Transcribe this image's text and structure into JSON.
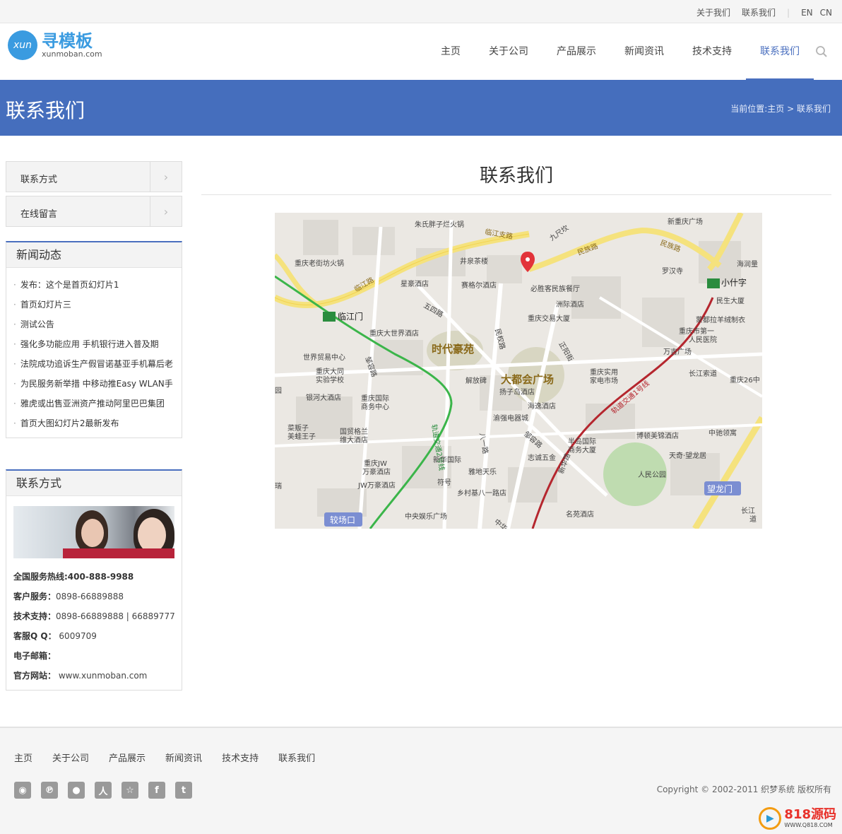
{
  "topbar": {
    "about": "关于我们",
    "contact": "联系我们",
    "en": "EN",
    "cn": "CN"
  },
  "logo": {
    "badge": "xun",
    "brand": "寻模板",
    "domain": "xunmoban.com"
  },
  "nav": {
    "items": [
      "主页",
      "关于公司",
      "产品展示",
      "新闻资讯",
      "技术支持",
      "联系我们"
    ],
    "active": "联系我们"
  },
  "banner": {
    "title": "联系我们",
    "breadcrumb": "当前位置:主页 > 联系我们"
  },
  "sidebar": {
    "buttons": [
      "联系方式",
      "在线留言"
    ],
    "news_title": "新闻动态",
    "news": [
      "发布：这个是首页幻灯片1",
      "首页幻灯片三",
      "测试公告",
      "强化多功能应用 手机银行进入普及期",
      "法院成功追诉生产假冒诺基亚手机幕后老",
      "为民服务新举措 中移动推Easy WLAN手",
      "雅虎或出售亚洲资产推动阿里巴巴集团",
      "首页大图幻灯片2最新发布"
    ],
    "contact_title": "联系方式",
    "contact": {
      "hotline_label": "全国服务热线:400-888-9988",
      "service_label": "客户服务：",
      "service_value": "0898-66889888",
      "tech_label": "技术支持：",
      "tech_value": "0898-66889888 | 66889777",
      "qq_label": "客服Q Q：",
      "qq_value": "6009709",
      "email_label": "电子邮箱：",
      "email_value": "",
      "site_label": "官方网站：",
      "site_value": "www.xunmoban.com"
    }
  },
  "main": {
    "title": "联系我们"
  },
  "map": {
    "labels": {
      "zhushi": "朱氏胖子烂火锅",
      "linjiangzhilu": "临江支路",
      "jiuchikan": "九尺坎",
      "xinchongqing": "新重庆广场",
      "laojiefang": "重庆老街坊火锅",
      "jingquan": "井泉茶楼",
      "minzulu": "民族路",
      "minzulu2": "民族路",
      "luohansi": "罗汉寺",
      "haiyun": "海润量",
      "linjianglu": "临江路",
      "xinghao": "星豪酒店",
      "saigeer": "赛格尔酒店",
      "bisheng": "必胜客民族餐厅",
      "xiaoshizi": "小什字",
      "zhouji": "洲际酒店",
      "minsheng": "民生大厦",
      "linjiangmen": "临江门",
      "wusilu": "五四路",
      "jiaoyi": "重庆交易大厦",
      "mengdula": "蒙都拉羊绒制衣",
      "shijie": "重庆大世界酒店",
      "minquanlu": "民权路",
      "zhengyang": "正阳街",
      "yiyuan1": "重庆市第一",
      "yiyuan2": "人民医院",
      "shidai": "时代豪苑",
      "wanji": "万吉广场",
      "maoyi": "世界贸易中心",
      "datong1": "重庆大同",
      "datong2": "实验学校",
      "zoumalu": "邹容路",
      "jiefangbei": "解放碑",
      "duhui": "大都会广场",
      "shiye1": "重庆实用",
      "shiye2": "家电市场",
      "suodao": "长江索道",
      "ershiliu": "重庆26中",
      "yangzidao": "扬子岛酒店",
      "yinhe": "银河大酒店",
      "guoji1": "重庆国际",
      "guoji2": "商务中心",
      "haiyi": "海逸酒店",
      "yuqiang": "渝强电器城",
      "caibanzi1": "菜贩子",
      "caibanzi2": "美蛙王子",
      "guomao1": "国贸格兰",
      "guomao2": "维大酒店",
      "zouronglu2": "邹容路",
      "bayilu": "八一路",
      "boshun": "博顿美锦酒店",
      "zhongchi": "中驰领寓",
      "bandao1": "半岛国际",
      "bandao2": "商务大厦",
      "tianqi": "天奇·望龙居",
      "jw1": "重庆JW",
      "jw2": "万豪酒店",
      "xinhua": "新华国际",
      "zhicheng": "志诚五金",
      "renmin": "人民公园",
      "yadi": "雅地天乐",
      "fuhao": "符号",
      "xinhualu": "新华路",
      "jwhotel": "JW万豪酒店",
      "xiangcun": "乡村基八一路店",
      "wanglongmen": "望龙门",
      "jiaochangkou": "较场口",
      "zhongyang": "中央娱乐广场",
      "mingyuan": "名苑酒店",
      "changjiang1": "长江",
      "changjiang2": "道",
      "line2": "轨道交通2号线",
      "line1": "轨道交通1号线",
      "zhonghua": "中华",
      "yuan": "园",
      "rui": "瑞"
    }
  },
  "footer": {
    "nav": [
      "主页",
      "关于公司",
      "产品展示",
      "新闻资讯",
      "技术支持",
      "联系我们"
    ],
    "copyright": "Copyright © 2002-2011 织梦系统 版权所有"
  },
  "watermark": {
    "big": "818源码",
    "small": "WWW.Q818.COM"
  }
}
